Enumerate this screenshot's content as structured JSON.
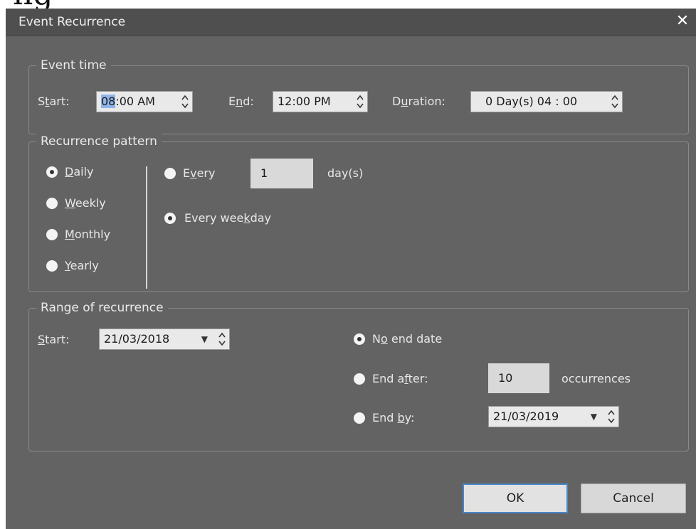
{
  "backdrop": {
    "fragment": "ng"
  },
  "window": {
    "title": "Event Recurrence",
    "close_glyph": "✕",
    "close_icon": "close-icon"
  },
  "event_time": {
    "legend": "Event time",
    "start_label_pre": "S",
    "start_label_mn": "t",
    "start_label_post": "art:",
    "start_hour": "08",
    "start_rest": ":00 AM",
    "end_label_pre": "E",
    "end_label_mn": "n",
    "end_label_post": "d:",
    "end_value": "12:00 PM",
    "duration_label_pre": "D",
    "duration_label_mn": "u",
    "duration_label_post": "ration:",
    "duration_value": "0 Day(s)  04 : 00"
  },
  "recurrence_pattern": {
    "legend": "Recurrence pattern",
    "options": [
      {
        "mn": "D",
        "rest": "aily",
        "selected": true
      },
      {
        "mn": "W",
        "rest": "eekly",
        "selected": false
      },
      {
        "mn": "M",
        "rest": "onthly",
        "selected": false
      },
      {
        "mn": "Y",
        "rest": "early",
        "selected": false
      }
    ],
    "every": {
      "pre": "E",
      "mn": "v",
      "post": "ery",
      "value": "1",
      "unit": "day(s)",
      "selected": false
    },
    "every_weekday": {
      "pre": "Every wee",
      "mn": "k",
      "post": "day",
      "selected": true
    }
  },
  "range": {
    "legend": "Range of recurrence",
    "start_label_mn": "S",
    "start_label_post": "tart:",
    "start_value": "21/03/2018",
    "no_end": {
      "pre": "N",
      "mn": "o",
      "post": " end date",
      "selected": true
    },
    "end_after": {
      "pre": "End a",
      "mn": "f",
      "post": "ter:",
      "value": "10",
      "unit": "occurrences",
      "selected": false
    },
    "end_by": {
      "pre": "End ",
      "mn": "b",
      "post": "y:",
      "value": "21/03/2019",
      "selected": false
    }
  },
  "buttons": {
    "ok": "OK",
    "cancel": "Cancel"
  }
}
